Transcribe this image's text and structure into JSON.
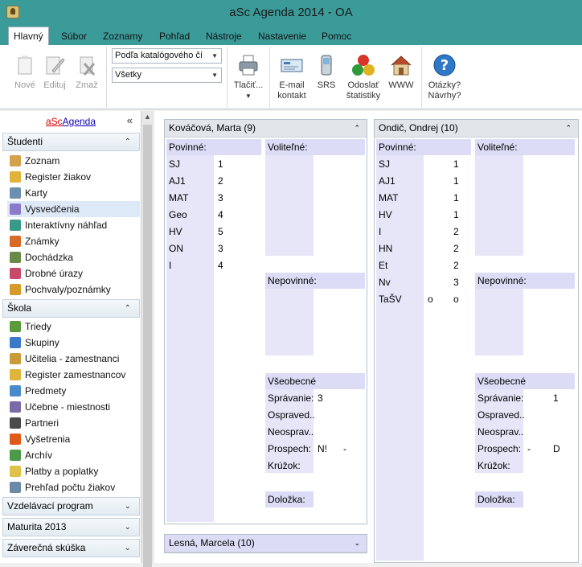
{
  "window": {
    "title": "aSc Agenda 2014 - OA"
  },
  "tabs": [
    "Hlavný",
    "Súbor",
    "Zoznamy",
    "Pohľad",
    "Nástroje",
    "Nastavenie",
    "Pomoc"
  ],
  "ribbon": {
    "new": "Nové",
    "edit": "Edituj",
    "delete": "Zmaž",
    "combo_sort": "Podľa katalógového čí",
    "combo_filter": "Všetky",
    "print": "Tlačiť...",
    "email_1": "E-mail",
    "email_2": "kontakt",
    "srs": "SRS",
    "stats_1": "Odoslať",
    "stats_2": "štatistiky",
    "www": "WWW",
    "help_1": "Otázky?",
    "help_2": "Návrhy?"
  },
  "sidebar": {
    "logo_a": "aSc",
    "logo_b": "Agenda",
    "collapse": "«",
    "sections": [
      {
        "label": "Študenti",
        "chev": "⌃"
      },
      {
        "label": "Škola",
        "chev": "⌃"
      },
      {
        "label": "Vzdelávací program",
        "chev": "⌄"
      },
      {
        "label": "Maturita 2013",
        "chev": "⌄"
      },
      {
        "label": "Záverečná skúška",
        "chev": "⌄"
      }
    ],
    "students_items": [
      "Zoznam",
      "Register žiakov",
      "Karty",
      "Vysvedčenia",
      "Interaktívny náhľad",
      "Známky",
      "Dochádzka",
      "Drobné úrazy",
      "Pochvaly/poznámky"
    ],
    "school_items": [
      "Triedy",
      "Skupiny",
      "Učitelia - zamestnanci",
      "Register zamestnancov",
      "Predmety",
      "Učebne - miestnosti",
      "Partneri",
      "Vyšetrenia",
      "Archív",
      "Platby a poplatky",
      "Prehľad počtu žiakov"
    ]
  },
  "cards": [
    {
      "name": "Kováčová, Marta (9)",
      "povinne": "Povinné:",
      "volitelne": "Voliteľné:",
      "nepovinne": "Nepovinné:",
      "vseobecne": "Všeobecné",
      "subjects": [
        [
          "SJ",
          "1"
        ],
        [
          "AJ1",
          "2"
        ],
        [
          "MAT",
          "3"
        ],
        [
          "Geo",
          "4"
        ],
        [
          "HV",
          "5"
        ],
        [
          "ON",
          "3"
        ],
        [
          "I",
          "4"
        ]
      ],
      "general": [
        [
          "Správanie:",
          "3",
          ""
        ],
        [
          "Ospraved...",
          "",
          ""
        ],
        [
          "Neosprav...",
          "",
          ""
        ],
        [
          "Prospech:",
          "N!",
          "-"
        ],
        [
          "Krúžok:",
          "",
          ""
        ]
      ],
      "dolozka": "Doložka:"
    },
    {
      "name": "Ondič, Ondrej (10)",
      "povinne": "Povinné:",
      "volitelne": "Voliteľné:",
      "nepovinne": "Nepovinné:",
      "vseobecne": "Všeobecné",
      "subjects": [
        [
          "SJ",
          "1"
        ],
        [
          "AJ1",
          "1"
        ],
        [
          "MAT",
          "1"
        ],
        [
          "HV",
          "1"
        ],
        [
          "I",
          "2"
        ],
        [
          "HN",
          "2"
        ],
        [
          "Et",
          "2"
        ],
        [
          "Nv",
          "3"
        ],
        [
          "TaŠV",
          "o",
          "o"
        ]
      ],
      "general": [
        [
          "Správanie:",
          "",
          "1"
        ],
        [
          "Ospraved...",
          "",
          ""
        ],
        [
          "Neosprav...",
          "",
          ""
        ],
        [
          "Prospech:",
          "-",
          "D"
        ],
        [
          "Krúžok:",
          "",
          ""
        ]
      ],
      "dolozka": "Doložka:"
    }
  ],
  "collapsed_card": {
    "name": "Lesná, Marcela (10)",
    "chev": "⌄"
  },
  "colors": {
    "titlebar": "#3b9b99",
    "column_fill": "#e6e6f8",
    "header_fill": "#dcdcf6"
  }
}
